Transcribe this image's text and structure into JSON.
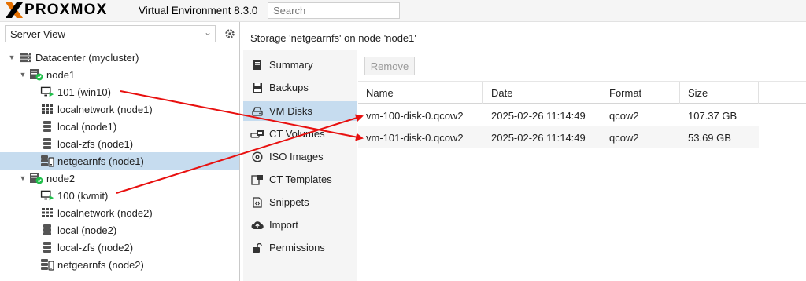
{
  "header": {
    "brand": "PROXMOX",
    "product": "Virtual Environment 8.3.0",
    "search_placeholder": "Search"
  },
  "sidebar": {
    "view_selector": "Server View",
    "tree": [
      {
        "label": "Datacenter (mycluster)",
        "icon": "datacenter-icon"
      },
      {
        "label": "node1",
        "icon": "node-online-icon"
      },
      {
        "label": "101 (win10)",
        "icon": "vm-running-icon"
      },
      {
        "label": "localnetwork (node1)",
        "icon": "sdn-icon"
      },
      {
        "label": "local (node1)",
        "icon": "storage-icon"
      },
      {
        "label": "local-zfs (node1)",
        "icon": "storage-icon"
      },
      {
        "label": "netgearnfs (node1)",
        "icon": "storage-nfs-icon",
        "selected": true
      },
      {
        "label": "node2",
        "icon": "node-online-icon"
      },
      {
        "label": "100 (kvmit)",
        "icon": "vm-running-icon"
      },
      {
        "label": "localnetwork (node2)",
        "icon": "sdn-icon"
      },
      {
        "label": "local (node2)",
        "icon": "storage-icon"
      },
      {
        "label": "local-zfs (node2)",
        "icon": "storage-icon"
      },
      {
        "label": "netgearnfs (node2)",
        "icon": "storage-nfs-icon"
      }
    ]
  },
  "main": {
    "title": "Storage 'netgearnfs' on node 'node1'",
    "nav": [
      {
        "label": "Summary",
        "icon": "book-icon"
      },
      {
        "label": "Backups",
        "icon": "floppy-icon"
      },
      {
        "label": "VM Disks",
        "icon": "hdd-icon",
        "active": true
      },
      {
        "label": "CT Volumes",
        "icon": "ct-volume-icon"
      },
      {
        "label": "ISO Images",
        "icon": "disc-icon"
      },
      {
        "label": "CT Templates",
        "icon": "template-icon"
      },
      {
        "label": "Snippets",
        "icon": "file-code-icon"
      },
      {
        "label": "Import",
        "icon": "cloud-upload-icon"
      },
      {
        "label": "Permissions",
        "icon": "unlock-icon"
      }
    ],
    "toolbar": {
      "remove_label": "Remove"
    },
    "grid": {
      "columns": [
        "Name",
        "Date",
        "Format",
        "Size"
      ],
      "rows": [
        [
          "vm-100-disk-0.qcow2",
          "2025-02-26 11:14:49",
          "qcow2",
          "107.37 GB"
        ],
        [
          "vm-101-disk-0.qcow2",
          "2025-02-26 11:14:49",
          "qcow2",
          "53.69 GB"
        ]
      ]
    }
  },
  "colors": {
    "selected_bg": "#c6dcef",
    "annotation_arrow": "#e8100f",
    "status_green": "#21bf4b",
    "brand_orange": "#e57000"
  }
}
